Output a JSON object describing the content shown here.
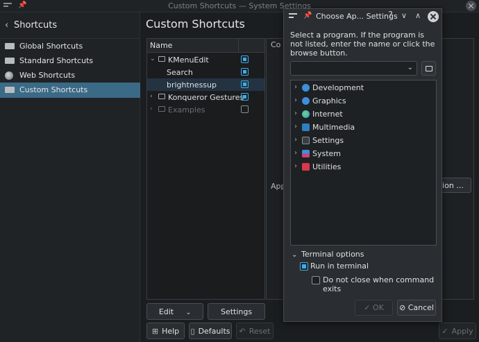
{
  "window": {
    "title": "Custom Shortcuts — System Settings"
  },
  "sidebar": {
    "back_label": "Shortcuts",
    "items": [
      {
        "label": "Global Shortcuts",
        "icon": "keyboard-icon"
      },
      {
        "label": "Standard Shortcuts",
        "icon": "keyboard-icon"
      },
      {
        "label": "Web Shortcuts",
        "icon": "globe-icon"
      },
      {
        "label": "Custom Shortcuts",
        "icon": "keyboard-icon",
        "active": true
      }
    ]
  },
  "page": {
    "title": "Custom Shortcuts"
  },
  "tree": {
    "header_name": "Name",
    "rows": [
      {
        "label": "KMenuEdit",
        "checked": true
      },
      {
        "label": "Search",
        "checked": true
      },
      {
        "label": "brightnessup",
        "checked": true,
        "selected": true
      },
      {
        "label": "Konqueror Gestures",
        "checked": true
      },
      {
        "label": "Examples",
        "checked": false,
        "disabled": true
      }
    ]
  },
  "right_panel": {
    "tab_label": "Co",
    "app_label": "App",
    "app_button": "ation ..."
  },
  "bottom": {
    "edit": "Edit",
    "settings": "Settings",
    "help": "Help",
    "defaults": "Defaults",
    "reset": "Reset",
    "apply": "Apply"
  },
  "dialog": {
    "title": "Choose Ap... Settings",
    "instruction": "Select a program. If the program is not listed, enter the name or click the browse button.",
    "combo_value": "",
    "categories": [
      {
        "label": "Development",
        "color": "#3d8fd9"
      },
      {
        "label": "Graphics",
        "color": "#3d8fd9"
      },
      {
        "label": "Internet",
        "color": "#2f9bd6"
      },
      {
        "label": "Multimedia",
        "color": "#2f7fc1"
      },
      {
        "label": "Settings",
        "color": "#8a9096"
      },
      {
        "label": "System",
        "color": "#c7437a"
      },
      {
        "label": "Utilities",
        "color": "#d9384a"
      }
    ],
    "terminal_options_label": "Terminal options",
    "run_in_terminal": {
      "label": "Run in terminal",
      "checked": true
    },
    "do_not_close": {
      "label": "Do not close when command exits",
      "checked": false
    },
    "ok_label": "OK",
    "cancel_label": "Cancel"
  },
  "colors": {
    "accent": "#3daee9",
    "selection": "#3b6a86",
    "background": "#1b1e20"
  }
}
